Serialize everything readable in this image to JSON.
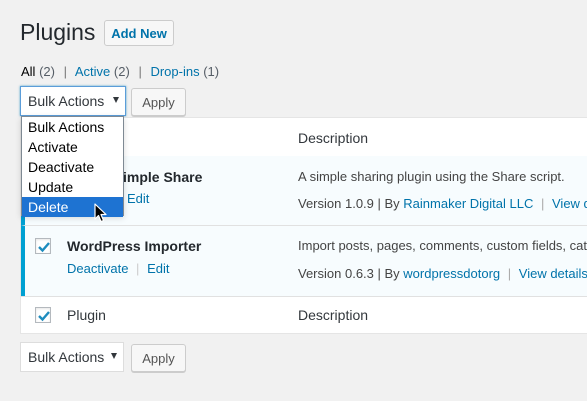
{
  "header": {
    "title": "Plugins",
    "add_new": "Add New"
  },
  "filters": [
    {
      "label": "All",
      "count": "(2)"
    },
    {
      "label": "Active",
      "count": "(2)"
    },
    {
      "label": "Drop-ins",
      "count": "(1)"
    }
  ],
  "bulk_top": {
    "selected": "Bulk Actions",
    "apply": "Apply"
  },
  "bulk_bottom": {
    "selected": "Bulk Actions",
    "apply": "Apply"
  },
  "dropdown": {
    "options": [
      "Bulk Actions",
      "Activate",
      "Deactivate",
      "Update",
      "Delete"
    ],
    "highlighted": "Delete"
  },
  "table": {
    "header": {
      "plugin": "Plugin",
      "description": "Description"
    },
    "footer": {
      "plugin": "Plugin",
      "description": "Description"
    },
    "rows": [
      {
        "name": "Simple Share",
        "visible_name": "imple Share",
        "actions": [
          "Edit"
        ],
        "description": "A simple sharing plugin using the Share script.",
        "version": "Version 1.0.9 | By",
        "author": "Rainmaker Digital LLC",
        "details": "View deta"
      },
      {
        "name": "WordPress Importer",
        "actions": [
          "Deactivate",
          "Edit"
        ],
        "description": "Import posts, pages, comments, custom fields, cate",
        "version": "Version 0.6.3 | By",
        "author": "wordpressdotorg",
        "details": "View details"
      }
    ]
  },
  "colors": {
    "accent": "#00a0d2",
    "link": "#0073aa",
    "highlight": "#1e73d2"
  }
}
